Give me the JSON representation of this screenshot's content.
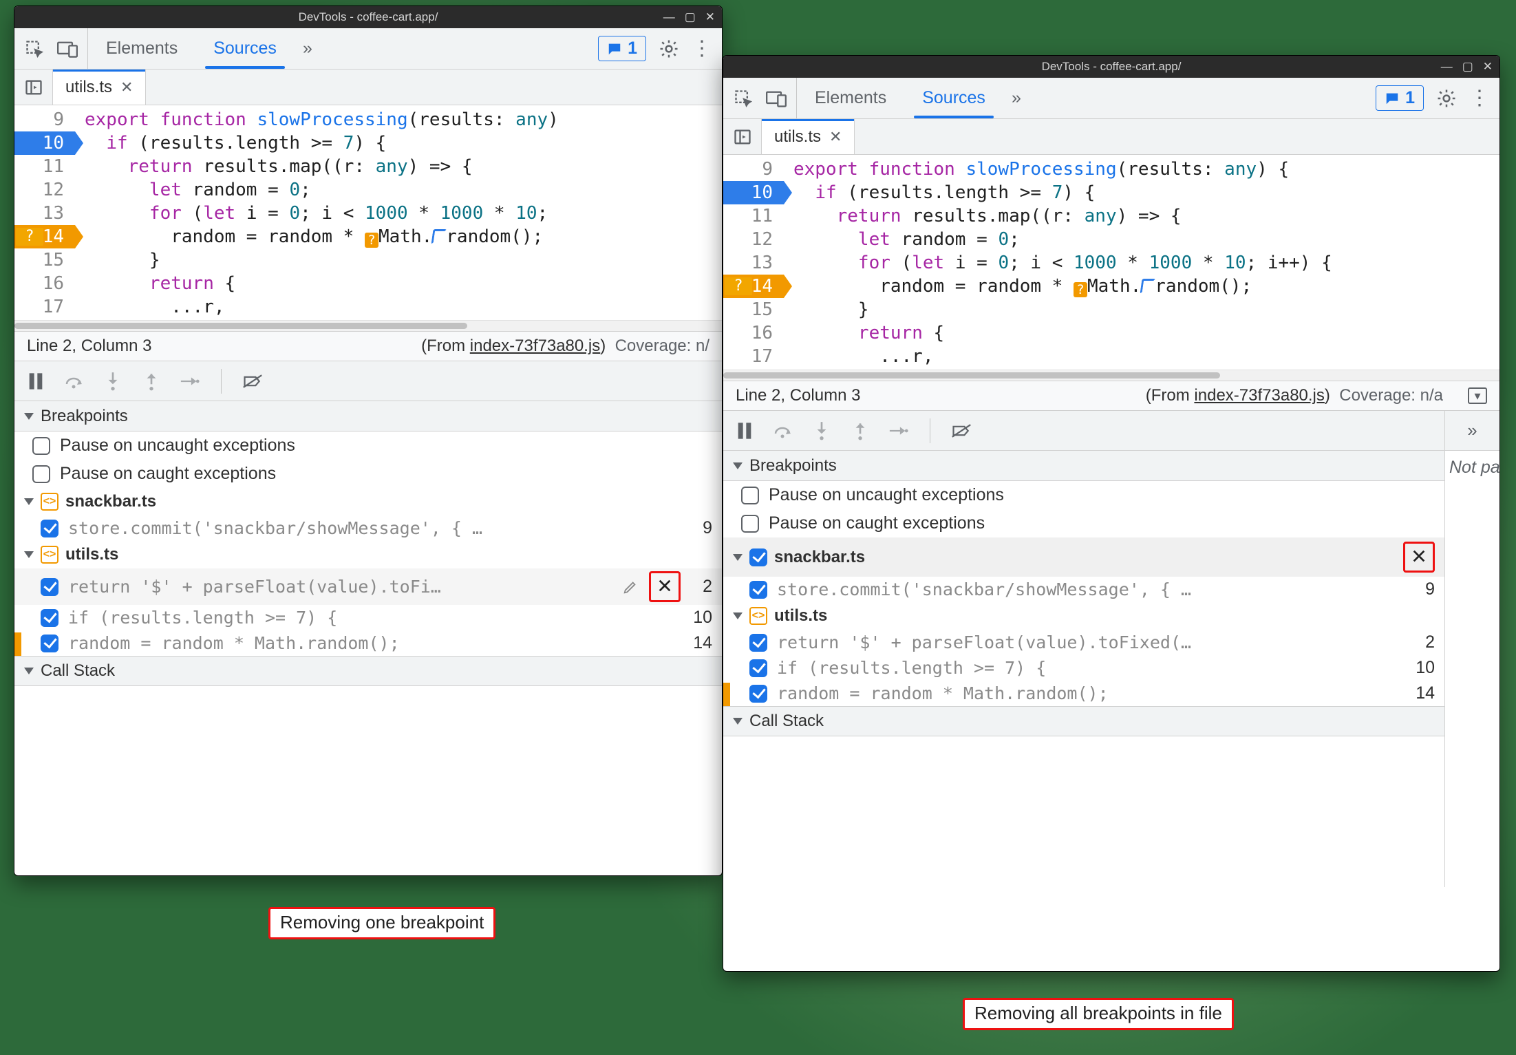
{
  "captions": {
    "left": "Removing one breakpoint",
    "right": "Removing all breakpoints in file"
  },
  "title": "DevTools - coffee-cart.app/",
  "toolbar": {
    "tabs": {
      "elements": "Elements",
      "sources": "Sources"
    },
    "msg_count": "1"
  },
  "file": {
    "name": "utils.ts"
  },
  "code": {
    "lines": [
      {
        "n": 9
      },
      {
        "n": 10,
        "bp": "blue"
      },
      {
        "n": 11
      },
      {
        "n": 12
      },
      {
        "n": 13
      },
      {
        "n": 14,
        "bp": "orange"
      },
      {
        "n": 15
      },
      {
        "n": 16
      },
      {
        "n": 17
      }
    ]
  },
  "status": {
    "pos": "Line 2, Column 3",
    "from_prefix": "(From ",
    "from_file": "index-73f73a80.js",
    "from_suffix": ")",
    "coverage_short": "Coverage: n/",
    "coverage_full": "Coverage: n/a"
  },
  "breakpoints": {
    "title": "Breakpoints",
    "uncaught": "Pause on uncaught exceptions",
    "caught": "Pause on caught exceptions",
    "files": [
      {
        "name": "snackbar.ts",
        "items": [
          {
            "snip": "store.commit('snackbar/showMessage', { …",
            "line": "9"
          }
        ]
      },
      {
        "name": "utils.ts",
        "items": [
          {
            "snip_short": "return '$' + parseFloat(value).toFi…",
            "snip_full": "return '$' + parseFloat(value).toFixed(…",
            "line": "2"
          },
          {
            "snip": "if (results.length >= 7) {",
            "line": "10"
          },
          {
            "snip": "random = random * Math.random();",
            "line": "14"
          }
        ]
      }
    ]
  },
  "callstack": {
    "title": "Call Stack"
  },
  "right_drawer": {
    "text": "Not pa"
  }
}
